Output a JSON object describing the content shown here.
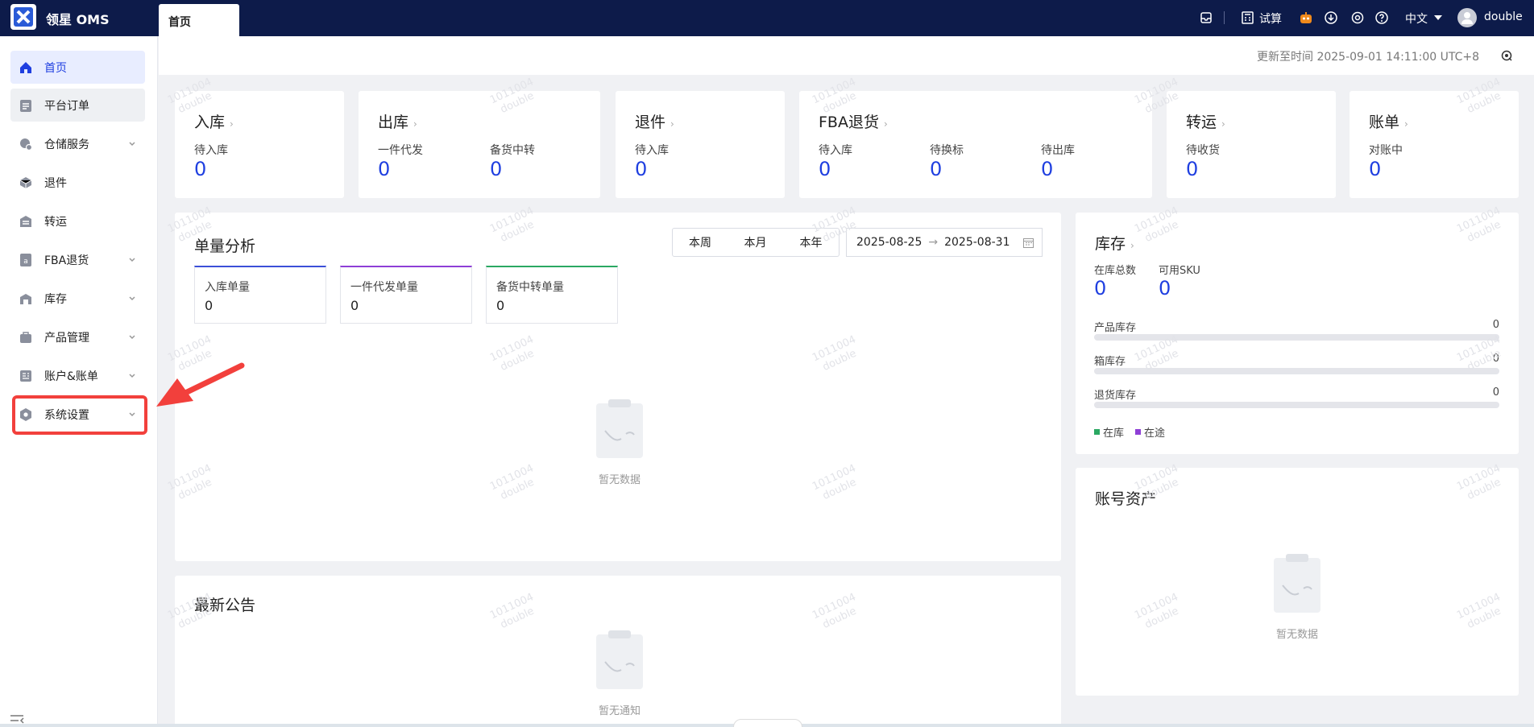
{
  "app": {
    "brand": "领星 OMS"
  },
  "tabs": [
    {
      "label": "首页"
    }
  ],
  "header": {
    "trial_label": "试算",
    "language": "中文",
    "username": "double"
  },
  "sidebar": {
    "items": [
      {
        "label": "首页",
        "icon": "home-icon"
      },
      {
        "label": "平台订单",
        "icon": "clipboard-icon"
      },
      {
        "label": "仓储服务",
        "icon": "warehouse-icon"
      },
      {
        "label": "退件",
        "icon": "return-box-icon"
      },
      {
        "label": "转运",
        "icon": "transfer-icon"
      },
      {
        "label": "FBA退货",
        "icon": "fba-icon"
      },
      {
        "label": "库存",
        "icon": "inventory-icon"
      },
      {
        "label": "产品管理",
        "icon": "product-icon"
      },
      {
        "label": "账户&账单",
        "icon": "billing-icon"
      },
      {
        "label": "系统设置",
        "icon": "settings-icon"
      }
    ]
  },
  "update": {
    "text": "更新至时间 2025-09-01 14:11:00 UTC+8"
  },
  "stat_cards": [
    {
      "title": "入库",
      "stats": [
        {
          "label": "待入库",
          "value": "0"
        }
      ]
    },
    {
      "title": "出库",
      "stats": [
        {
          "label": "一件代发",
          "value": "0"
        },
        {
          "label": "备货中转",
          "value": "0"
        }
      ]
    },
    {
      "title": "退件",
      "stats": [
        {
          "label": "待入库",
          "value": "0"
        }
      ]
    },
    {
      "title": "FBA退货",
      "stats": [
        {
          "label": "待入库",
          "value": "0"
        },
        {
          "label": "待换标",
          "value": "0"
        },
        {
          "label": "待出库",
          "value": "0"
        }
      ]
    },
    {
      "title": "转运",
      "stats": [
        {
          "label": "待收货",
          "value": "0"
        }
      ]
    },
    {
      "title": "账单",
      "stats": [
        {
          "label": "对账中",
          "value": "0"
        }
      ]
    }
  ],
  "analysis": {
    "title": "单量分析",
    "periods": [
      "本周",
      "本月",
      "本年"
    ],
    "date_start": "2025-08-25",
    "date_end": "2025-08-31",
    "metrics": [
      {
        "label": "入库单量",
        "value": "0",
        "color": "#3b4fd8"
      },
      {
        "label": "一件代发单量",
        "value": "0",
        "color": "#8e3fd6"
      },
      {
        "label": "备货中转单量",
        "value": "0",
        "color": "#2aa862"
      }
    ],
    "empty_text": "暂无数据"
  },
  "inventory": {
    "title": "库存",
    "stats": [
      {
        "label": "在库总数",
        "value": "0"
      },
      {
        "label": "可用SKU",
        "value": "0"
      }
    ],
    "bars": [
      {
        "label": "产品库存",
        "value": "0"
      },
      {
        "label": "箱库存",
        "value": "0"
      },
      {
        "label": "退货库存",
        "value": "0"
      }
    ],
    "legend": [
      {
        "label": "在库",
        "color": "#2aa862"
      },
      {
        "label": "在途",
        "color": "#8e3fd6"
      }
    ]
  },
  "assets": {
    "title": "账号资产",
    "empty_text": "暂无数据"
  },
  "announcements": {
    "title": "最新公告",
    "empty_text": "暂无通知"
  },
  "watermark": {
    "line1": "1011004",
    "line2": "double"
  },
  "colors": {
    "accent": "#1f3fe0",
    "topbar": "#0d1b4a",
    "highlight": "#f2403c"
  }
}
